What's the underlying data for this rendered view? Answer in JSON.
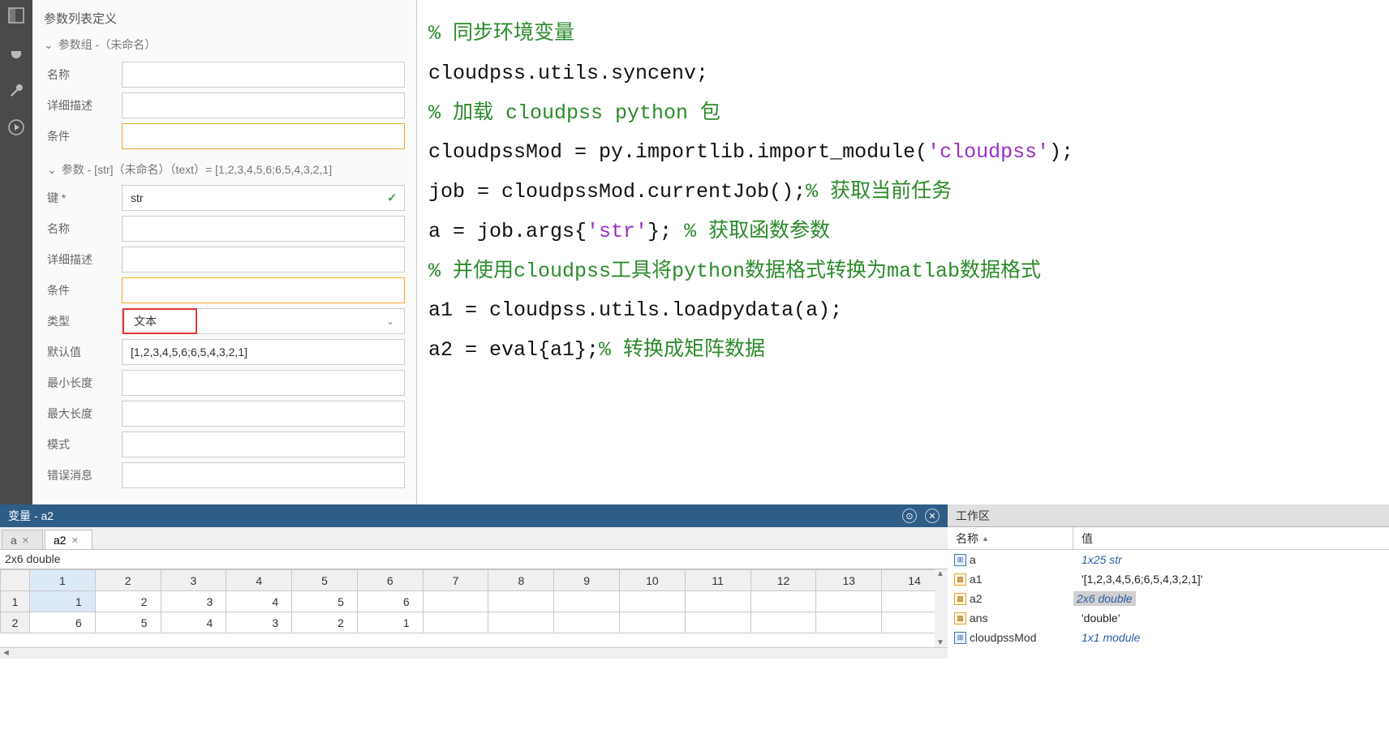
{
  "iconbar": {
    "i1": "layout-icon",
    "i2": "plug-icon",
    "i3": "wrench-icon",
    "i4": "play-icon"
  },
  "panel": {
    "title": "参数列表定义",
    "group_header": "参数组 -（未命名）",
    "labels": {
      "name": "名称",
      "detail": "详细描述",
      "cond": "条件",
      "key": "键 *",
      "ptype": "类型",
      "defv": "默认值",
      "minlen": "最小长度",
      "maxlen": "最大长度",
      "pattern": "模式",
      "errmsg": "错误消息"
    },
    "sub_header": "参数 - [str]（未命名）（text）= [1,2,3,4,5,6;6,5,4,3,2,1]",
    "values": {
      "key": "str",
      "type": "文本",
      "def": "[1,2,3,4,5,6;6,5,4,3,2,1]"
    }
  },
  "code": {
    "l1_comment": "% 同步环境变量",
    "l2": "cloudpss.utils.syncenv;",
    "l3_comment": "% 加载 cloudpss python 包",
    "l4_a": "cloudpssMod = py.importlib.import_module(",
    "l4_s": "'cloudpss'",
    "l4_b": ");",
    "l5_a": "job = cloudpssMod.currentJob();",
    "l5_c": "% 获取当前任务",
    "l6_a": "a = job.args{",
    "l6_s": "'str'",
    "l6_b": "}; ",
    "l6_c": "% 获取函数参数",
    "l7_comment": "% 并使用cloudpss工具将python数据格式转换为matlab数据格式",
    "l8": "a1 = cloudpss.utils.loadpydata(a);",
    "l9_a": "a2 = eval{a1};",
    "l9_c": "% 转换成矩阵数据"
  },
  "var": {
    "header": "变量 - a2",
    "tabs": [
      {
        "label": "a",
        "active": false
      },
      {
        "label": "a2",
        "active": true
      }
    ],
    "info": "2x6 double",
    "cols": [
      "1",
      "2",
      "3",
      "4",
      "5",
      "6",
      "7",
      "8",
      "9",
      "10",
      "11",
      "12",
      "13",
      "14"
    ],
    "rows": [
      {
        "hdr": "1",
        "cells": [
          "1",
          "2",
          "3",
          "4",
          "5",
          "6",
          "",
          "",
          "",
          "",
          "",
          "",
          "",
          ""
        ]
      },
      {
        "hdr": "2",
        "cells": [
          "6",
          "5",
          "4",
          "3",
          "2",
          "1",
          "",
          "",
          "",
          "",
          "",
          "",
          "",
          ""
        ]
      }
    ]
  },
  "ws": {
    "title": "工作区",
    "col_name": "名称",
    "col_val": "值",
    "items": [
      {
        "name": "a",
        "value": "1x25 str",
        "style": "italic",
        "icon": "struct"
      },
      {
        "name": "a1",
        "value": "'[1,2,3,4,5,6;6,5,4,3,2,1]'",
        "style": "normal",
        "icon": "cell"
      },
      {
        "name": "a2",
        "value": "2x6 double",
        "style": "hl",
        "icon": "cell"
      },
      {
        "name": "ans",
        "value": "'double'",
        "style": "normal",
        "icon": "cell"
      },
      {
        "name": "cloudpssMod",
        "value": "1x1 module",
        "style": "italic",
        "icon": "struct"
      }
    ]
  }
}
